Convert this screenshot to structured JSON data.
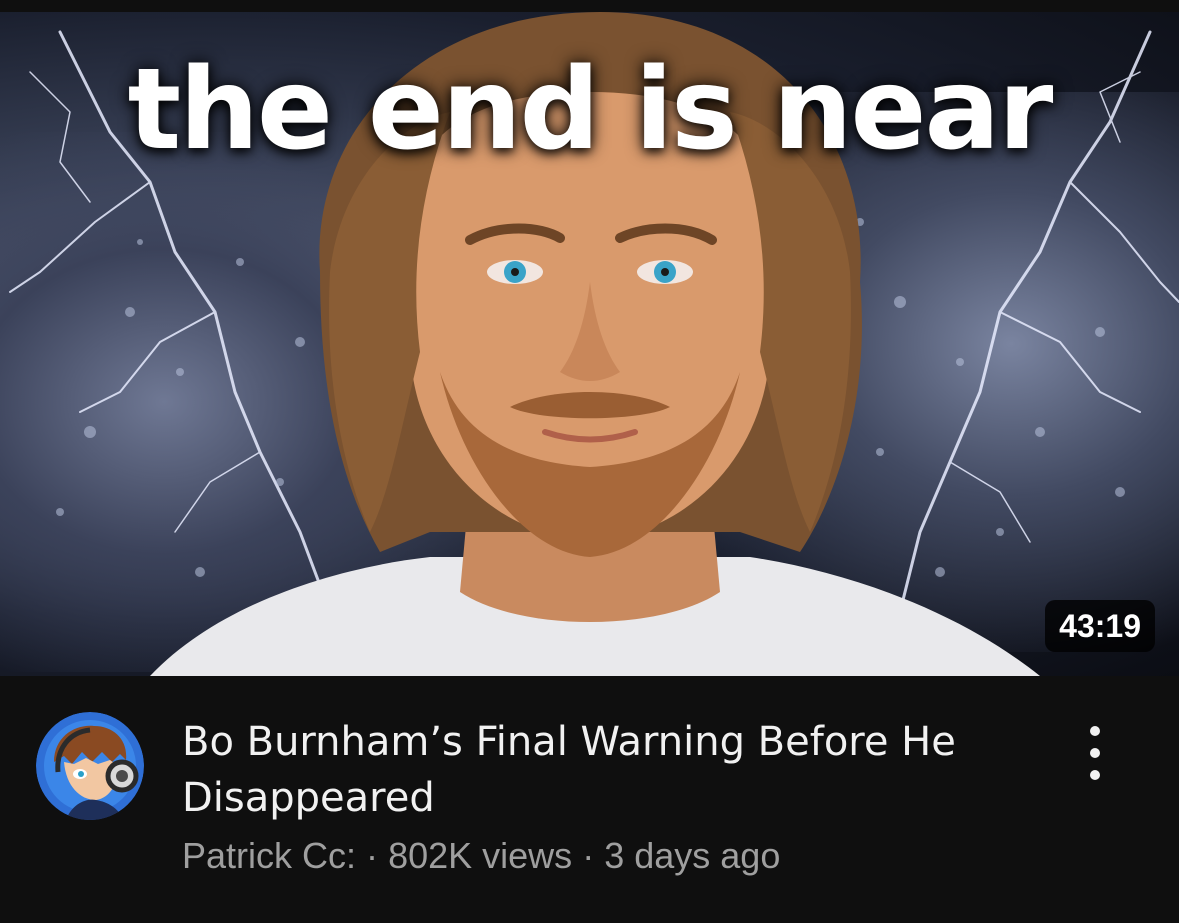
{
  "thumbnail": {
    "overlay_text": "the end is near",
    "duration": "43:19"
  },
  "video": {
    "title": "Bo Burnham’s Final Warning Before He Disappeared",
    "channel": "Patrick Cc:",
    "separator": "·",
    "views": "802K views",
    "age": "3 days ago"
  },
  "icons": {
    "more": "more-vertical-icon",
    "avatar": "channel-avatar"
  },
  "colors": {
    "background": "#0f0f0f",
    "title": "#f1f1f1",
    "meta": "#9f9f9f",
    "avatar_ring": "#3a7bd5"
  }
}
